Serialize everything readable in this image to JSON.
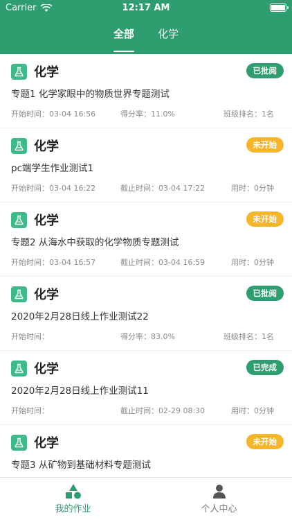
{
  "status_bar": {
    "carrier": "Carrier",
    "time": "12:17 AM"
  },
  "tabs": [
    {
      "label": "全部",
      "active": true
    },
    {
      "label": "化学",
      "active": false
    }
  ],
  "cards": [
    {
      "subject": "化学",
      "status": "已批阅",
      "status_type": "done",
      "title": "专题1 化学家眼中的物质世界专题测试",
      "meta": [
        "开始时间：03-04 16:56",
        "得分率：11.0%",
        "班级排名：1名"
      ]
    },
    {
      "subject": "化学",
      "status": "未开始",
      "status_type": "pending",
      "title": "pc端学生作业测试1",
      "meta": [
        "开始时间：03-04 16:22",
        "截止时间：03-04 17:22",
        "用时：0分钟"
      ]
    },
    {
      "subject": "化学",
      "status": "未开始",
      "status_type": "pending",
      "title": "专题2 从海水中获取的化学物质专题测试",
      "meta": [
        "开始时间：03-04 16:57",
        "截止时间：03-04 16:59",
        "用时：0分钟"
      ]
    },
    {
      "subject": "化学",
      "status": "已批阅",
      "status_type": "done",
      "title": "2020年2月28日线上作业测试22",
      "meta": [
        "开始时间：",
        "得分率：83.0%",
        "班级排名：1名"
      ]
    },
    {
      "subject": "化学",
      "status": "已完成",
      "status_type": "done",
      "title": "2020年2月28日线上作业测试11",
      "meta": [
        "开始时间：",
        "截止时间：02-29 08:30",
        "用时：0分钟"
      ]
    },
    {
      "subject": "化学",
      "status": "未开始",
      "status_type": "pending",
      "title": "专题3 从矿物到基础材料专题测试",
      "meta": [
        "",
        "",
        ""
      ]
    }
  ],
  "bottom_nav": [
    {
      "label": "我的作业",
      "icon": "shapes-icon",
      "active": true
    },
    {
      "label": "个人中心",
      "icon": "person-icon",
      "active": false
    }
  ],
  "colors": {
    "primary": "#2e9d6f",
    "pending": "#f7b52c",
    "icon_bg": "#3eb98a"
  }
}
